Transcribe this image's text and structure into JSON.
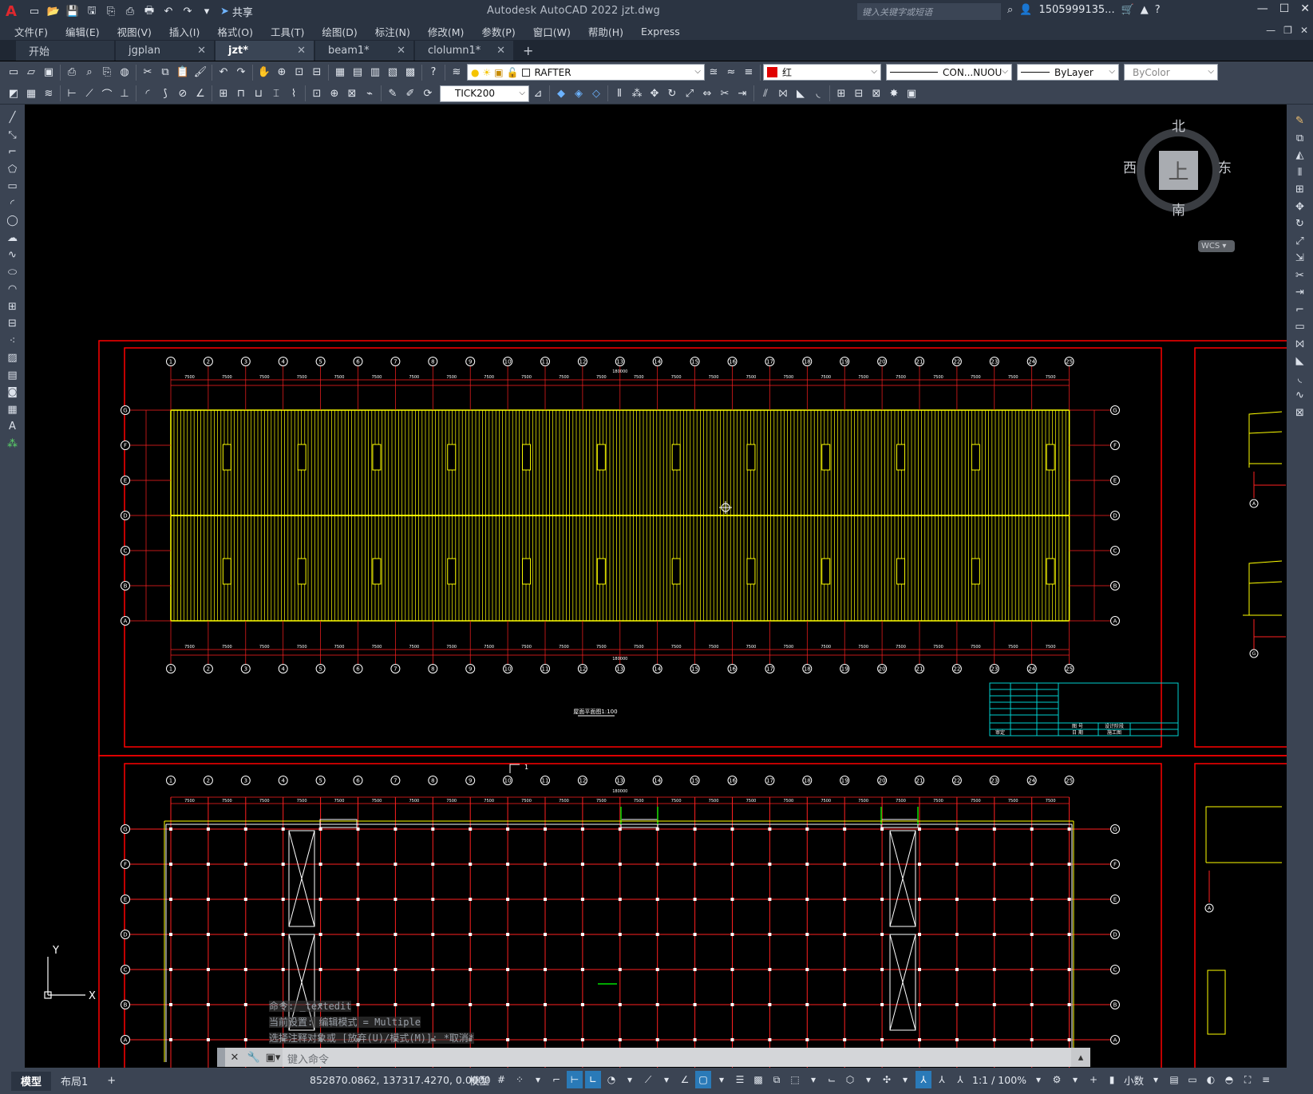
{
  "title_bar": {
    "app_logo": "A",
    "share_label": "共享",
    "window_title": "Autodesk AutoCAD 2022    jzt.dwg",
    "search_placeholder": "键入关键字或短语",
    "user_name": "1505999135..."
  },
  "menu": [
    "文件(F)",
    "编辑(E)",
    "视图(V)",
    "插入(I)",
    "格式(O)",
    "工具(T)",
    "绘图(D)",
    "标注(N)",
    "修改(M)",
    "参数(P)",
    "窗口(W)",
    "帮助(H)",
    "Express"
  ],
  "tabs": [
    {
      "label": "开始",
      "active": false,
      "closable": false
    },
    {
      "label": "jgplan",
      "active": false,
      "closable": true
    },
    {
      "label": "jzt*",
      "active": true,
      "closable": true
    },
    {
      "label": "beam1*",
      "active": false,
      "closable": true
    },
    {
      "label": "clolumn1*",
      "active": false,
      "closable": true
    }
  ],
  "properties": {
    "layer": "RAFTER",
    "color": "红",
    "color_hex": "#e00000",
    "linetype": "CON...NUOU",
    "lineweight": "ByLayer",
    "plot_style": "ByColor",
    "dim_style": "TICK200"
  },
  "viewcube": {
    "north": "北",
    "south": "南",
    "east": "东",
    "west": "西",
    "face": "上",
    "wcs": "WCS"
  },
  "ucs": {
    "x_label": "X",
    "y_label": "Y"
  },
  "drawing": {
    "grid_numbers": [
      "1",
      "2",
      "3",
      "4",
      "5",
      "6",
      "7",
      "8",
      "9",
      "10",
      "11",
      "12",
      "13",
      "14",
      "15",
      "16",
      "17",
      "18",
      "19",
      "20",
      "21",
      "22",
      "23",
      "24",
      "25"
    ],
    "grid_letters": [
      "G",
      "F",
      "E",
      "D",
      "C",
      "B",
      "A"
    ],
    "bay_dim": "7500",
    "total_dim": "180000",
    "plan_title": "屋面平面图1:100",
    "section_marker": "1",
    "title_block": {
      "approve": "审定",
      "sheet_no_label": "图 号",
      "date_label": "日 期",
      "project": "设计阶段",
      "drawing_no": "施工图"
    },
    "colors": {
      "frame": "#ff0000",
      "roof": "#ffff00",
      "grid": "#ff2020",
      "titleblock": "#00d0d0",
      "dim": "#ffffff"
    }
  },
  "command_history": [
    "命令:  _textedit",
    "当前设置: 编辑模式 = Multiple",
    "选择注释对象或 [放弃(U)/模式(M)]: *取消*"
  ],
  "command_input_placeholder": "键入命令",
  "status": {
    "layout_tabs": [
      "模型",
      "布局1"
    ],
    "coordinates": "852870.0862, 137317.4270, 0.0000",
    "model_label": "模型",
    "scale": "1:1 / 100%",
    "units": "小数"
  }
}
